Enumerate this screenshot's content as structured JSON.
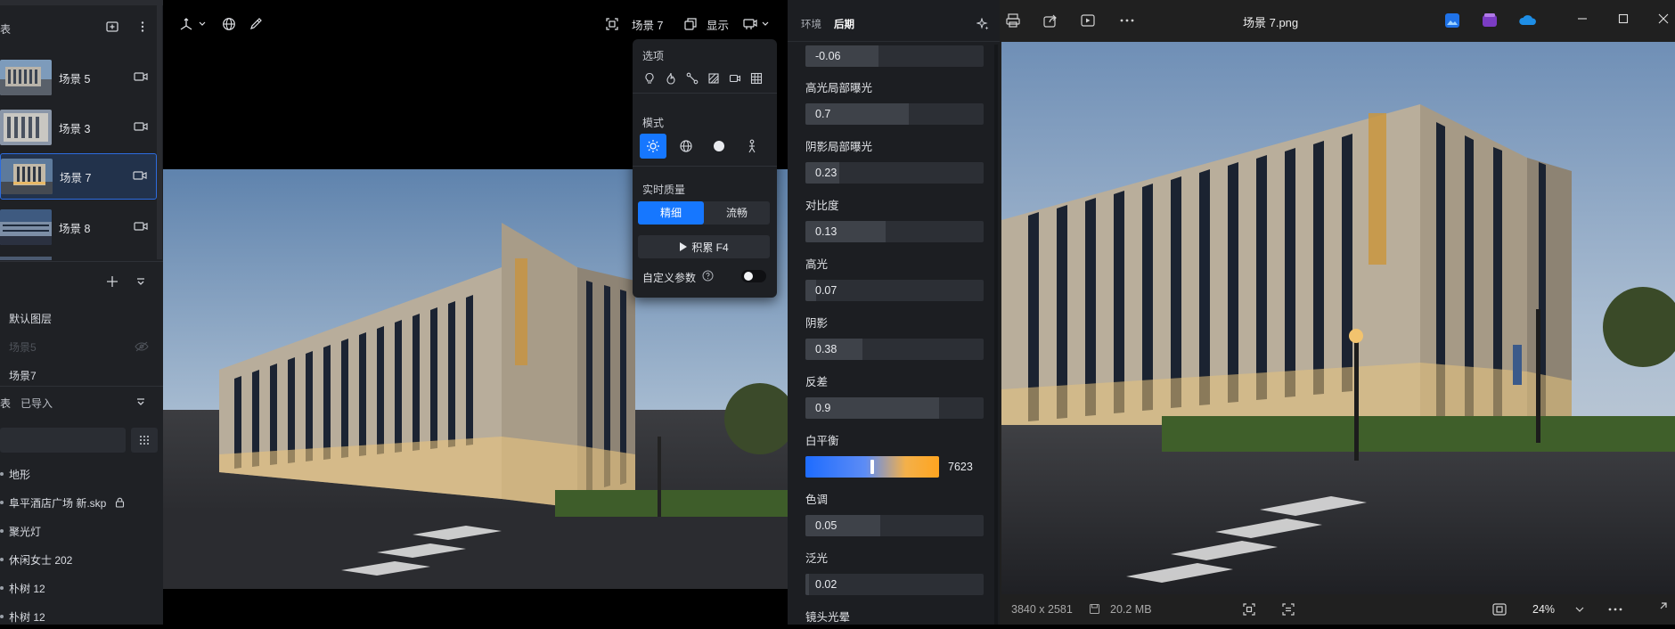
{
  "left_panel": {
    "header_label": "表",
    "scenes": [
      {
        "label": "场景 5",
        "selected": false
      },
      {
        "label": "场景 3",
        "selected": false
      },
      {
        "label": "场景 7",
        "selected": true
      },
      {
        "label": "场景 8",
        "selected": false
      }
    ],
    "layers": {
      "items": [
        "默认图层",
        "场景5",
        "场景7"
      ]
    },
    "assets": {
      "header_label": "表",
      "imported_label": "已导入",
      "items": [
        "地形",
        "阜平酒店广场 新.skp",
        "聚光灯",
        "休闲女士 202",
        "朴树 12",
        "朴树 12"
      ]
    }
  },
  "viewport": {
    "scene_label": "场景 7",
    "display_label": "显示"
  },
  "popup": {
    "options_title": "选项",
    "mode_title": "模式",
    "quality_title": "实时质量",
    "quality_options": [
      "精细",
      "流畅"
    ],
    "quality_selected": "精细",
    "accumulate_label": "积累 F4",
    "custom_params_label": "自定义参数",
    "custom_params_enabled": false
  },
  "params_panel": {
    "tabs": [
      "环境",
      "后期"
    ],
    "active_tab": "后期",
    "top_value": "-0.06",
    "top_fill": 0.41,
    "params": [
      {
        "label": "高光局部曝光",
        "value": "0.7",
        "fill": 0.58
      },
      {
        "label": "阴影局部曝光",
        "value": "0.23",
        "fill": 0.19
      },
      {
        "label": "对比度",
        "value": "0.13",
        "fill": 0.45
      },
      {
        "label": "高光",
        "value": "0.07",
        "fill": 0.06
      },
      {
        "label": "阴影",
        "value": "0.38",
        "fill": 0.32
      },
      {
        "label": "反差",
        "value": "0.9",
        "fill": 0.75
      }
    ],
    "white_balance": {
      "label": "白平衡",
      "value": "7623",
      "fill": 0.5
    },
    "params2": [
      {
        "label": "色调",
        "value": "0.05",
        "fill": 0.42
      },
      {
        "label": "泛光",
        "value": "0.02",
        "fill": 0.02
      }
    ],
    "bottom_label": "镜头光晕"
  },
  "viewer": {
    "title": "场景 7.png",
    "dimensions": "3840 x 2581",
    "file_size": "20.2 MB",
    "zoom": "24%"
  },
  "colors": {
    "accent": "#1677ff",
    "panel_bg": "#1f2125",
    "params_bg": "#1c1e22",
    "viewer_bg": "#202020"
  }
}
